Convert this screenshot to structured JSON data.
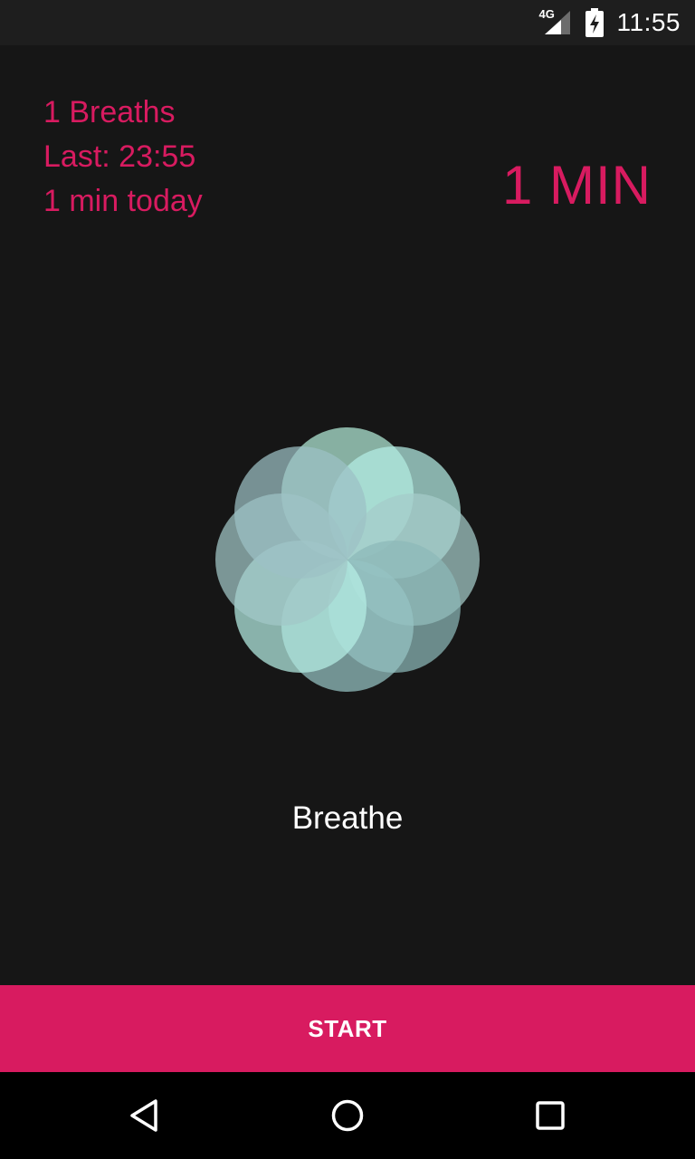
{
  "status_bar": {
    "network": "4G",
    "time": "11:55",
    "icons": [
      "signal-icon",
      "battery-charging-icon"
    ]
  },
  "stats": {
    "breaths": "1 Breaths",
    "last": "Last: 23:55",
    "today": "1 min today"
  },
  "duration": "1 MIN",
  "animation_label": "Breathe",
  "start_button_label": "START",
  "nav": {
    "icons": [
      "back-icon",
      "home-icon",
      "recents-icon"
    ]
  },
  "colors": {
    "accent": "#d81b60",
    "background": "#161616",
    "petal_light": "#a8e6dc",
    "petal_dark": "#5fa3a0"
  }
}
